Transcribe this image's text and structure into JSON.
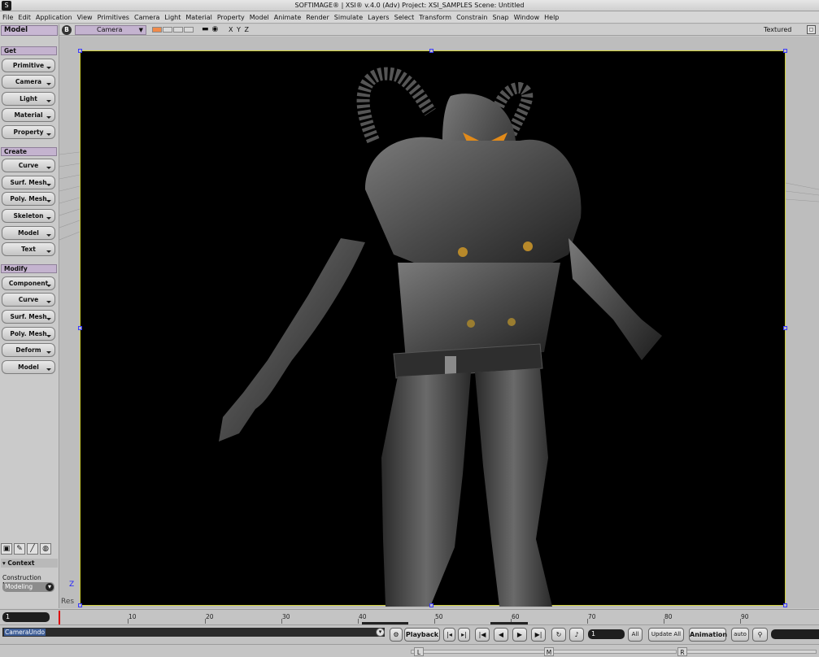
{
  "window": {
    "title": "SOFTIMAGE® | XSI® v.4.0 (Adv) Project: XSI_SAMPLES    Scene: Untitled"
  },
  "menu": [
    "File",
    "Edit",
    "Application",
    "View",
    "Primitives",
    "Camera",
    "Light",
    "Material",
    "Property",
    "Model",
    "Animate",
    "Render",
    "Simulate",
    "Layers",
    "Select",
    "Transform",
    "Constrain",
    "Snap",
    "Window",
    "Help"
  ],
  "leftpanel": {
    "mode": "Model",
    "sections": {
      "get": {
        "title": "Get",
        "items": [
          "Primitive",
          "Camera",
          "Light",
          "Material",
          "Property"
        ]
      },
      "create": {
        "title": "Create",
        "items": [
          "Curve",
          "Surf. Mesh",
          "Poly. Mesh",
          "Skeleton",
          "Model",
          "Text"
        ]
      },
      "modify": {
        "title": "Modify",
        "items": [
          "Component",
          "Curve",
          "Surf. Mesh",
          "Poly. Mesh",
          "Deform",
          "Model"
        ]
      }
    },
    "context": {
      "title": "Context",
      "mode_label": "Construction Mode",
      "mode_value": "Modeling"
    }
  },
  "viewport": {
    "letter": "B",
    "camera": "Camera",
    "axes": "X Y Z",
    "shading": "Textured",
    "axis_z": "Z",
    "res_label": "Res"
  },
  "timeline": {
    "start_frame": "1",
    "ticks": [
      "10",
      "20",
      "30",
      "40",
      "50",
      "60",
      "70",
      "80",
      "90"
    ]
  },
  "bottom": {
    "command": "CameraUndo",
    "playback": "Playback",
    "frame": "1",
    "all": "All",
    "update_all": "Update All",
    "animation": "Animation",
    "auto": "auto"
  },
  "status": {
    "mouse": [
      "L",
      "M",
      "R"
    ]
  },
  "colors": {
    "panel_accent": "#c4b3cf",
    "viewport_bg": "#000000",
    "frame_border": "#cfcf3a"
  }
}
